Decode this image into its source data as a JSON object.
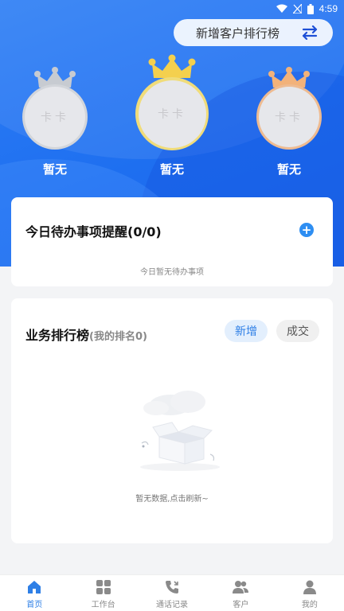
{
  "status_bar": {
    "time": "4:59"
  },
  "header": {
    "rank_button_label": "新增客户排行榜"
  },
  "podium": [
    {
      "position": "left",
      "avatar_text": "卡卡",
      "name": "暂无",
      "crown_color": "#c7cbd1"
    },
    {
      "position": "center",
      "avatar_text": "卡卡",
      "name": "暂无",
      "crown_color": "#f4d04e"
    },
    {
      "position": "right",
      "avatar_text": "卡卡",
      "name": "暂无",
      "crown_color": "#f2b27a"
    }
  ],
  "todo_card": {
    "title": "今日待办事项提醒(0/0)",
    "empty_text": "今日暂无待办事项"
  },
  "business_card": {
    "title": "业务排行榜",
    "subtitle": "(我的排名0)",
    "tabs": [
      "新增",
      "成交"
    ],
    "empty_text": "暂无数据,点击刷新~"
  },
  "tabbar": {
    "items": [
      {
        "label": "首页",
        "icon": "home-icon",
        "active": true
      },
      {
        "label": "工作台",
        "icon": "grid-icon",
        "active": false
      },
      {
        "label": "通话记录",
        "icon": "phone-icon",
        "active": false
      },
      {
        "label": "客户",
        "icon": "users-icon",
        "active": false
      },
      {
        "label": "我的",
        "icon": "person-icon",
        "active": false
      }
    ]
  },
  "colors": {
    "primary": "#1e6ff0",
    "accent": "#2e7fe6"
  }
}
